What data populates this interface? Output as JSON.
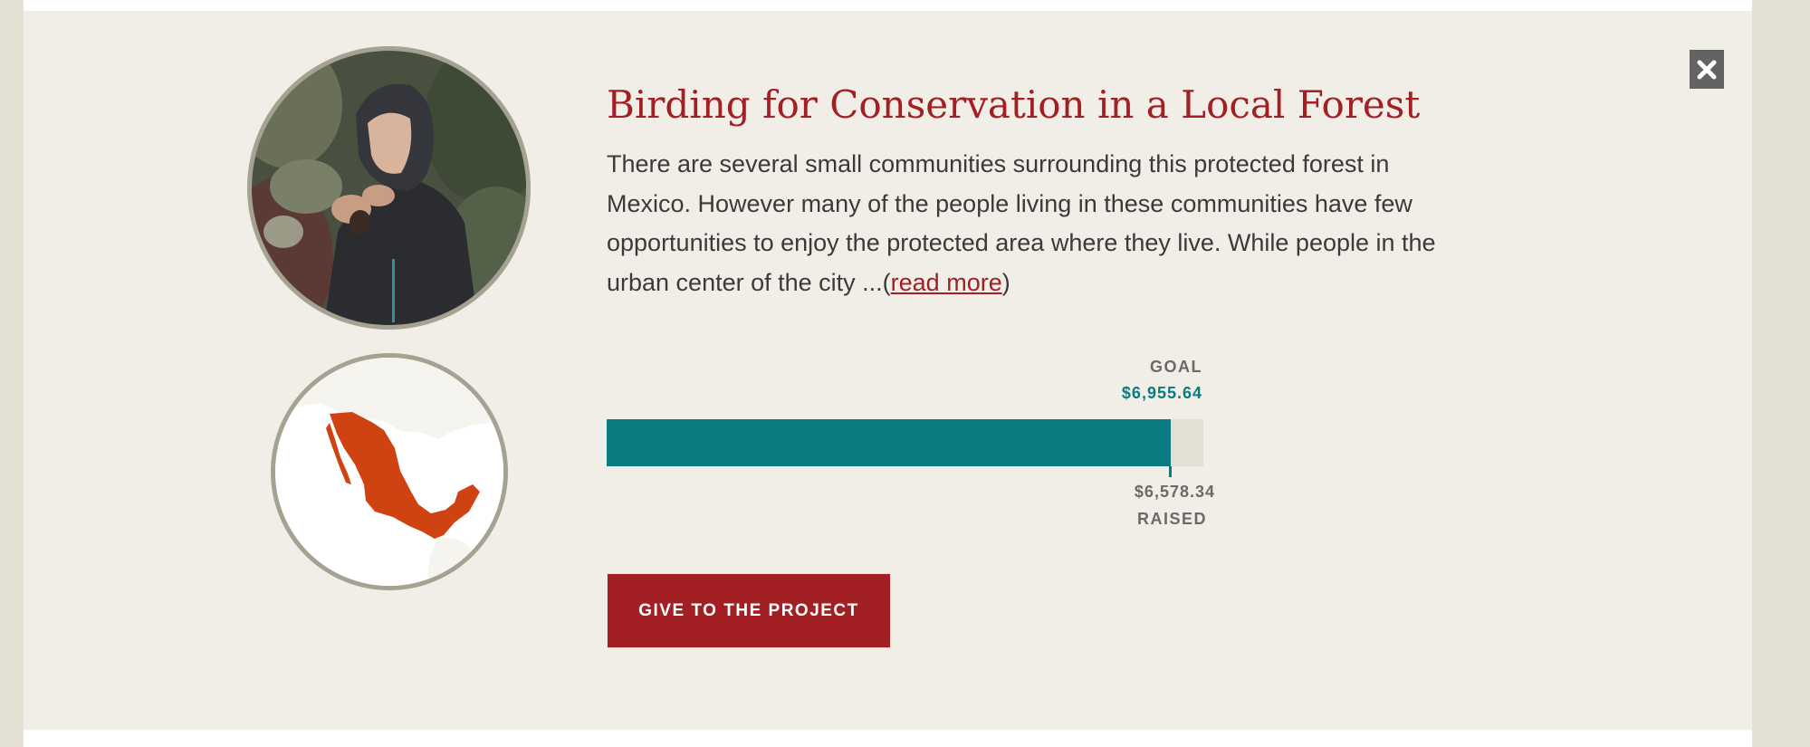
{
  "project": {
    "title": "Birding for Conservation in a Local Forest",
    "description_text": "There are several small communities surrounding this protected forest in Mexico. However many of the people living in these communities have few opportunities to enjoy the protected area where they live. While people in the urban center of the city ...(",
    "read_more_label": "read more",
    "description_close": ")",
    "country_highlight": "Mexico"
  },
  "progress": {
    "goal_label": "GOAL",
    "goal_value": "$6,955.64",
    "raised_value": "$6,578.34",
    "raised_label": "RAISED",
    "fraction_raised": 0.9458
  },
  "actions": {
    "give_label": "GIVE TO THE PROJECT",
    "close_icon": "close-icon"
  },
  "colors": {
    "accent_red": "#a21f24",
    "progress_teal": "#0a7b80",
    "map_orange": "#cf4313",
    "panel_bg": "#f1eee7"
  }
}
